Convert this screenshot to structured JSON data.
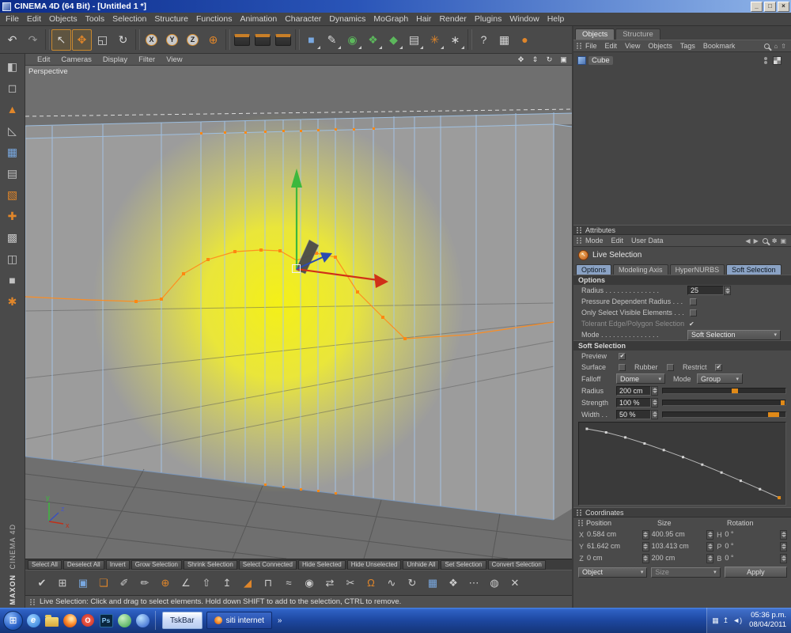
{
  "glyphs": {
    "check": "✔",
    "dropdown": "▾",
    "back": "◀",
    "forward": "▶",
    "home": "⌂",
    "up": "⇧",
    "key": "✽",
    "frame": "▣",
    "cursor": "↖"
  },
  "titlebar": {
    "title": "CINEMA 4D (64 Bit) - [Untitled 1 *]",
    "minimize": "_",
    "maximize": "□",
    "close": "×"
  },
  "menubar": {
    "items": [
      "File",
      "Edit",
      "Objects",
      "Tools",
      "Selection",
      "Structure",
      "Functions",
      "Animation",
      "Character",
      "Dynamics",
      "MoGraph",
      "Hair",
      "Render",
      "Plugins",
      "Window",
      "Help"
    ]
  },
  "toolbar": {
    "icons": [
      {
        "name": "undo-icon",
        "glyph": "↶"
      },
      {
        "name": "redo-icon",
        "glyph": "↷"
      },
      {
        "name": "live-selection-icon",
        "glyph": "↖"
      },
      {
        "name": "move-icon",
        "glyph": "✥"
      },
      {
        "name": "scale-icon",
        "glyph": "◱"
      },
      {
        "name": "rotate-icon",
        "glyph": "↻"
      },
      {
        "name": "lock-x-icon",
        "glyph": "X"
      },
      {
        "name": "lock-y-icon",
        "glyph": "Y"
      },
      {
        "name": "lock-z-icon",
        "glyph": "Z"
      },
      {
        "name": "coordinate-system-icon",
        "glyph": "⊕"
      },
      {
        "name": "render-view-icon",
        "glyph": ""
      },
      {
        "name": "render-picture-viewer-icon",
        "glyph": ""
      },
      {
        "name": "render-settings-icon",
        "glyph": ""
      },
      {
        "name": "add-cube-icon",
        "glyph": "■"
      },
      {
        "name": "add-spline-icon",
        "glyph": "✎"
      },
      {
        "name": "add-nurbs-icon",
        "glyph": "◉"
      },
      {
        "name": "add-array-icon",
        "glyph": "❖"
      },
      {
        "name": "add-deformer-icon",
        "glyph": "◆"
      },
      {
        "name": "add-environment-icon",
        "glyph": "▤"
      },
      {
        "name": "add-camera-light-icon",
        "glyph": "✳"
      },
      {
        "name": "add-particles-icon",
        "glyph": "∗"
      },
      {
        "name": "help-icon",
        "glyph": "?"
      },
      {
        "name": "console-icon",
        "glyph": "▦"
      },
      {
        "name": "c4d-sphere-icon",
        "glyph": "●"
      }
    ]
  },
  "palette": {
    "icons": [
      {
        "name": "make-editable-icon",
        "glyph": "◧"
      },
      {
        "name": "model-mode-icon",
        "glyph": "◻"
      },
      {
        "name": "texture-mode-icon",
        "glyph": "▲"
      },
      {
        "name": "workplane-mode-icon",
        "glyph": "◺"
      },
      {
        "name": "points-mode-icon",
        "glyph": "▦"
      },
      {
        "name": "edges-mode-icon",
        "glyph": "▤"
      },
      {
        "name": "polygons-mode-icon",
        "glyph": "▧"
      },
      {
        "name": "axis-mode-icon",
        "glyph": "✚"
      },
      {
        "name": "texture-tag-mode-icon",
        "glyph": "▩"
      },
      {
        "name": "uv-mode-icon",
        "glyph": "◫"
      },
      {
        "name": "snap-mode-icon",
        "glyph": "■"
      },
      {
        "name": "magnet-tool-icon",
        "glyph": "✱"
      }
    ]
  },
  "viewport": {
    "label": "Perspective",
    "menu": [
      "Edit",
      "Cameras",
      "Display",
      "Filter",
      "View"
    ],
    "controls": [
      {
        "name": "pan-icon",
        "glyph": "✥"
      },
      {
        "name": "zoom-icon",
        "glyph": "⇕"
      },
      {
        "name": "orbit-icon",
        "glyph": "↻"
      },
      {
        "name": "toggle-view-icon",
        "glyph": "▣"
      }
    ],
    "axis": {
      "x": "x",
      "y": "y",
      "z": "z"
    }
  },
  "object_manager": {
    "tabs": [
      "Objects",
      "Structure"
    ],
    "menu": [
      "File",
      "Edit",
      "View",
      "Objects",
      "Tags",
      "Bookmark"
    ],
    "objects": [
      {
        "name": "Cube"
      }
    ]
  },
  "attributes": {
    "header": "Attributes",
    "menu": [
      "Mode",
      "Edit",
      "User Data"
    ],
    "tool": "Live Selection",
    "tabs": [
      "Options",
      "Modeling Axis",
      "HyperNURBS",
      "Soft Selection"
    ],
    "options": {
      "header": "Options",
      "rows": [
        {
          "label": "Radius . . . . . . . . . . . . . .",
          "value": "25"
        },
        {
          "label": "Pressure Dependent Radius . . .",
          "checked": false
        },
        {
          "label": "Only Select Visible Elements . . .",
          "checked": false
        },
        {
          "label": "Tolerant Edge/Polygon Selection",
          "checked": true
        },
        {
          "label": "Mode . . . . . . . . . . . . . . .",
          "value": "Soft Selection"
        }
      ]
    },
    "soft_selection": {
      "header": "Soft Selection",
      "preview_label": "Preview",
      "preview_checked": true,
      "surface_label": "Surface",
      "surface_checked": false,
      "rubber_label": "Rubber",
      "rubber_checked": false,
      "restrict_label": "Restrict",
      "restrict_checked": true,
      "falloff_label": "Falloff",
      "falloff_value": "Dome",
      "mode_label": "Mode",
      "mode_value": "Group",
      "radius_label": "Radius",
      "radius_value": "200 cm",
      "strength_label": "Strength",
      "strength_value": "100 %",
      "width_label": "Width . .",
      "width_value": "50 %"
    }
  },
  "coordinates": {
    "header": "Coordinates",
    "columns": [
      "Position",
      "Size",
      "Rotation"
    ],
    "position": {
      "x_label": "X",
      "x": "0.584 cm",
      "y_label": "Y",
      "y": "61.642 cm",
      "z_label": "Z",
      "z": "0 cm"
    },
    "size": {
      "x": "400.95 cm",
      "y": "103.413 cm",
      "z": "200 cm"
    },
    "rotation": {
      "h_label": "H",
      "h": "0 °",
      "p_label": "P",
      "p": "0 °",
      "b_label": "B",
      "b": "0 °"
    },
    "object_mode": "Object",
    "size_mode": "Size",
    "apply": "Apply"
  },
  "selection_bar": {
    "buttons": [
      "Select All",
      "Deselect All",
      "Invert",
      "Grow Selection",
      "Shrink Selection",
      "Select Connected",
      "Hide Selected",
      "Hide Unselected",
      "Unhide All",
      "Set Selection",
      "Convert Selection"
    ]
  },
  "bottom_toolbar": {
    "icons": [
      {
        "name": "apply-check-icon",
        "glyph": "✔"
      },
      {
        "name": "points-grid-icon",
        "glyph": "⊞"
      },
      {
        "name": "create-cube-icon",
        "glyph": "▣"
      },
      {
        "name": "cube-stack-icon",
        "glyph": "❏"
      },
      {
        "name": "knife-icon",
        "glyph": "✐"
      },
      {
        "name": "pen-icon",
        "glyph": "✏"
      },
      {
        "name": "add-polygon-icon",
        "glyph": "⊕"
      },
      {
        "name": "angle-measure-icon",
        "glyph": "∠"
      },
      {
        "name": "extrude-icon",
        "glyph": "⇧"
      },
      {
        "name": "inner-extrude-icon",
        "glyph": "↥"
      },
      {
        "name": "bevel-icon",
        "glyph": "◢"
      },
      {
        "name": "bridge-icon",
        "glyph": "⊓"
      },
      {
        "name": "stitch-sew-icon",
        "glyph": "≈"
      },
      {
        "name": "weld-icon",
        "glyph": "◉"
      },
      {
        "name": "mirror-icon",
        "glyph": "⇄"
      },
      {
        "name": "scissors-icon",
        "glyph": "✂"
      },
      {
        "name": "magnet-icon",
        "glyph": "Ω"
      },
      {
        "name": "smooth-shift-icon",
        "glyph": "∿"
      },
      {
        "name": "spin-edge-icon",
        "glyph": "↻"
      },
      {
        "name": "subdivide-icon",
        "glyph": "▦"
      },
      {
        "name": "matrix-extrude-icon",
        "glyph": "❖"
      },
      {
        "name": "optimize-icon",
        "glyph": "⋯"
      },
      {
        "name": "close-hole-icon",
        "glyph": "◍"
      },
      {
        "name": "delete-icon",
        "glyph": "✕"
      }
    ]
  },
  "status_bar": {
    "text": "Live Selection: Click and drag to select elements. Hold down SHIFT to add to the selection, CTRL to remove."
  },
  "taskbar": {
    "start_glyph": "⊞",
    "quick_launch": [
      {
        "name": "ie-icon",
        "glyph": "e"
      },
      {
        "name": "folder-icon",
        "glyph": ""
      },
      {
        "name": "firefox-icon",
        "glyph": ""
      },
      {
        "name": "opera-icon",
        "glyph": "O"
      },
      {
        "name": "photoshop-icon",
        "glyph": "Ps"
      },
      {
        "name": "messenger-icon",
        "glyph": ""
      },
      {
        "name": "globe-icon",
        "glyph": ""
      }
    ],
    "tasks": [
      {
        "label": "TskBar"
      },
      {
        "label": "siti internet"
      }
    ],
    "overflow": "»",
    "tray_icons": [
      {
        "name": "tray-keyboard-icon",
        "glyph": "▦"
      },
      {
        "name": "tray-eject-icon",
        "glyph": "↥"
      },
      {
        "name": "tray-volume-icon",
        "glyph": "◄)"
      }
    ],
    "clock": {
      "time": "05:36 p.m.",
      "date": "08/04/2011"
    }
  },
  "branding": {
    "maxon": "MAXON",
    "product": "CINEMA 4D"
  }
}
